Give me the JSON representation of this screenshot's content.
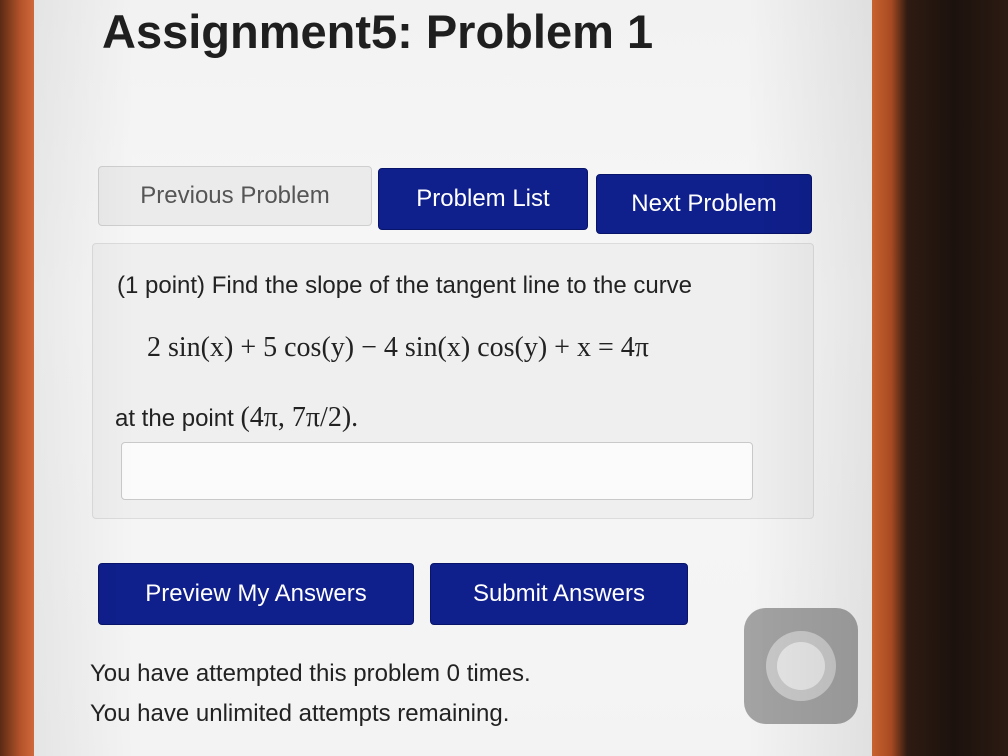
{
  "page": {
    "title": "Assignment5: Problem 1"
  },
  "nav": {
    "previous_label": "Previous Problem",
    "list_label": "Problem List",
    "next_label": "Next Problem"
  },
  "problem": {
    "intro": "(1 point) Find the slope of the tangent line to the curve",
    "equation": "2 sin(x) + 5 cos(y) − 4 sin(x) cos(y) + x = 4π",
    "point_prefix": "at the point",
    "point_value": "(4π, 7π/2).",
    "answer_value": ""
  },
  "actions": {
    "preview_label": "Preview My Answers",
    "submit_label": "Submit Answers"
  },
  "status": {
    "attempted": "You have attempted this problem 0 times.",
    "remaining": "You have unlimited attempts remaining."
  },
  "colors": {
    "primary_button": "#0f1f8c",
    "secondary_button": "#ebebeb",
    "phone_frame": "#c8622f"
  }
}
